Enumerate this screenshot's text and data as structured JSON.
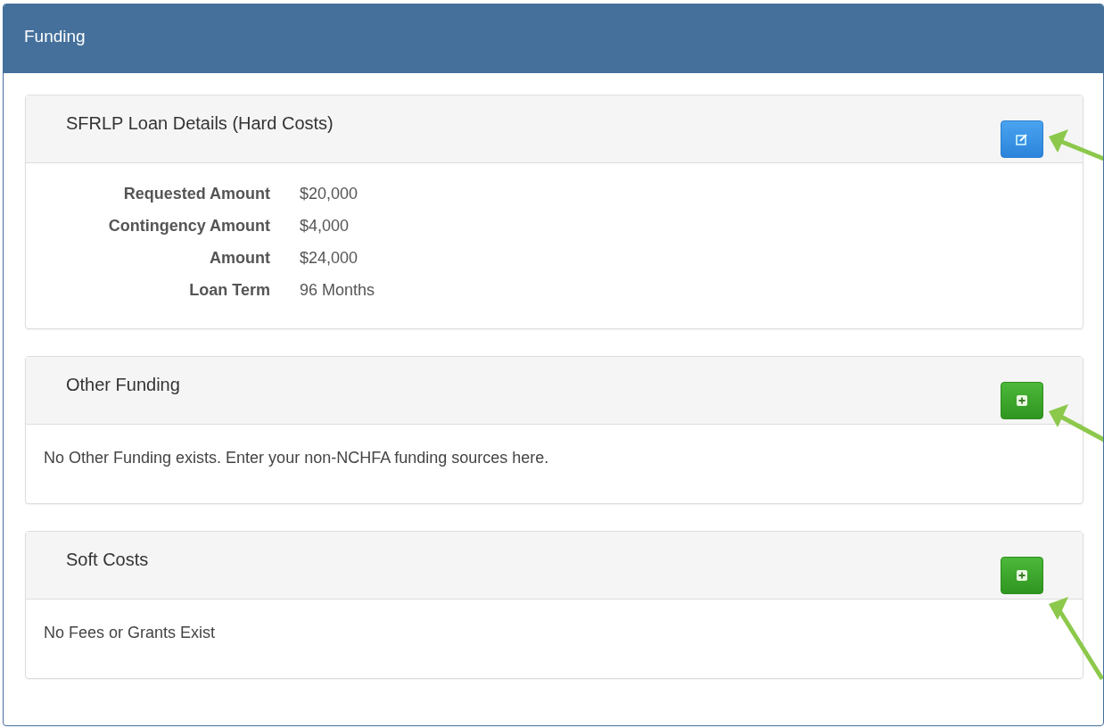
{
  "header": {
    "title": "Funding"
  },
  "panels": [
    {
      "title": "SFRLP Loan Details (Hard Costs)",
      "button": {
        "kind": "edit"
      },
      "kind": "details",
      "rows": [
        {
          "label": "Requested Amount",
          "value": "$20,000"
        },
        {
          "label": "Contingency Amount",
          "value": "$4,000"
        },
        {
          "label": "Amount",
          "value": "$24,000"
        },
        {
          "label": "Loan Term",
          "value": "96 Months"
        }
      ]
    },
    {
      "title": "Other Funding",
      "button": {
        "kind": "add"
      },
      "kind": "message",
      "text": "No Other Funding exists. Enter your non-NCHFA funding sources here."
    },
    {
      "title": "Soft Costs",
      "button": {
        "kind": "add"
      },
      "kind": "message",
      "text": "No Fees or Grants Exist"
    }
  ]
}
